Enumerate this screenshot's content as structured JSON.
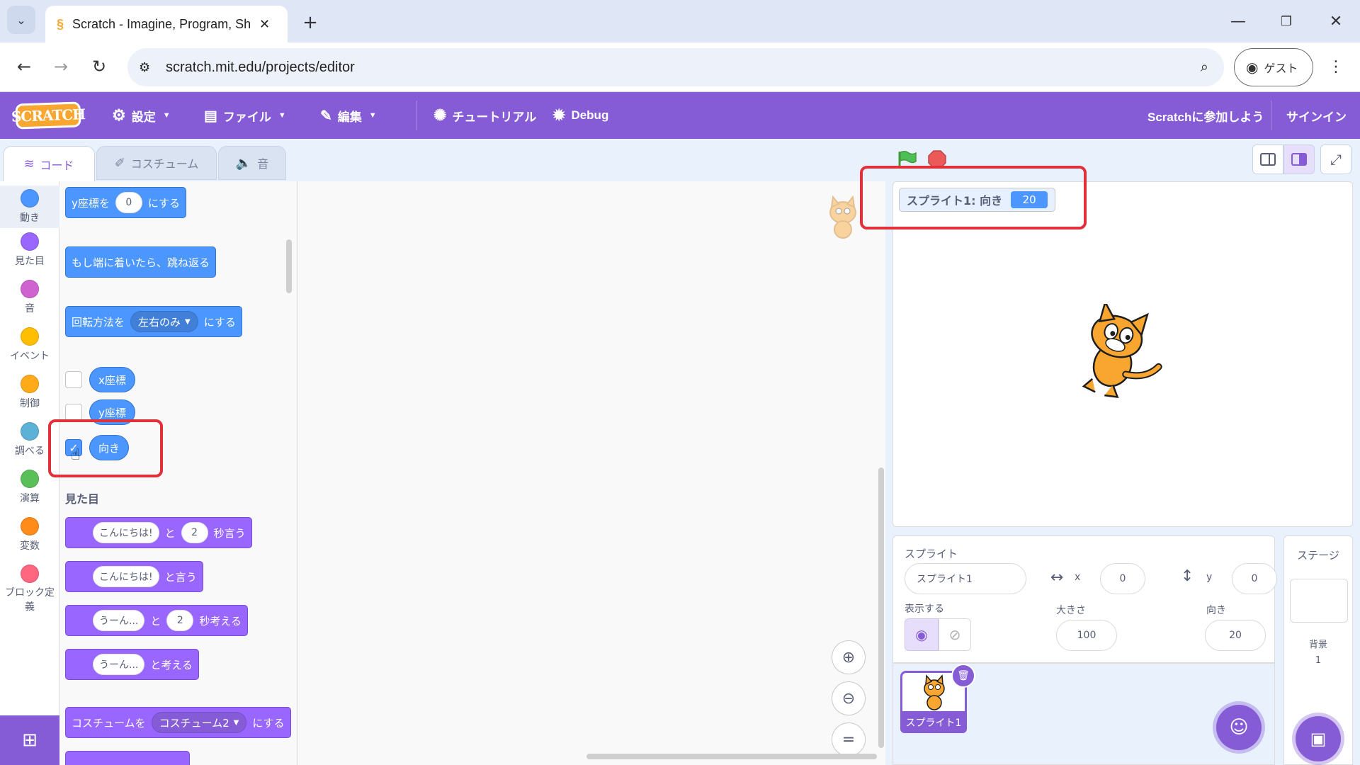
{
  "browser": {
    "tab_title": "Scratch - Imagine, Program, Sha",
    "url": "scratch.mit.edu/projects/editor",
    "profile_label": "ゲスト"
  },
  "menubar": {
    "logo": "SCRATCH",
    "settings": "設定",
    "file": "ファイル",
    "edit": "編集",
    "tutorials": "チュートリアル",
    "debug": "Debug",
    "join": "Scratchに参加しよう",
    "signin": "サインイン"
  },
  "tabs": {
    "code": "コード",
    "costumes": "コスチューム",
    "sounds": "音"
  },
  "categories": [
    {
      "label": "動き",
      "color": "#4c97ff"
    },
    {
      "label": "見た目",
      "color": "#9966ff"
    },
    {
      "label": "音",
      "color": "#cf63cf"
    },
    {
      "label": "イベント",
      "color": "#ffbf00"
    },
    {
      "label": "制御",
      "color": "#ffab19"
    },
    {
      "label": "調べる",
      "color": "#5cb1d6"
    },
    {
      "label": "演算",
      "color": "#59c059"
    },
    {
      "label": "変数",
      "color": "#ff8c1a"
    },
    {
      "label": "ブロック定義",
      "color": "#ff6680"
    }
  ],
  "palette": {
    "set_y_pre": "y座標を",
    "set_y_val": "0",
    "set_y_post": "にする",
    "bounce": "もし端に着いたら、跳ね返る",
    "rotation_pre": "回転方法を",
    "rotation_val": "左右のみ",
    "rotation_post": "にする",
    "x_position": "x座標",
    "y_position": "y座標",
    "direction": "向き",
    "looks_heading": "見た目",
    "say_for_text": "こんにちは!",
    "say_for_mid": "と",
    "say_for_secs": "2",
    "say_for_post": "秒言う",
    "say_text": "こんにちは!",
    "say_post": "と言う",
    "think_for_text": "うーん...",
    "think_for_mid": "と",
    "think_for_secs": "2",
    "think_for_post": "秒考える",
    "think_text": "うーん...",
    "think_post": "と考える",
    "costume_pre": "コスチュームを",
    "costume_val": "コスチューム2",
    "costume_post": "にする"
  },
  "checkboxes": {
    "x_position": false,
    "y_position": false,
    "direction": true
  },
  "monitor": {
    "label": "スプライト1: 向き",
    "value": "20"
  },
  "sprite_info": {
    "title": "スプライト",
    "name": "スプライト1",
    "x_label": "x",
    "x_value": "0",
    "y_label": "y",
    "y_value": "0",
    "show_label": "表示する",
    "size_label": "大きさ",
    "size_value": "100",
    "direction_label": "向き",
    "direction_value": "20"
  },
  "sprite_list": [
    {
      "name": "スプライト1"
    }
  ],
  "stage_panel": {
    "title": "ステージ",
    "backdrops_label": "背景",
    "backdrops_count": "1"
  },
  "colors": {
    "accent": "#855cd6",
    "motion": "#4c97ff",
    "looks": "#9966ff",
    "highlight": "#e0303a"
  }
}
